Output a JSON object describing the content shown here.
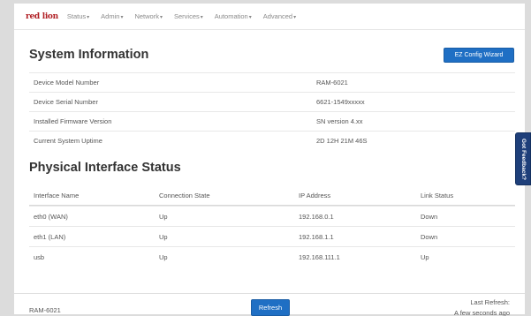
{
  "nav": {
    "logo": "red lion",
    "menu": [
      {
        "label": "Status"
      },
      {
        "label": "Admin"
      },
      {
        "label": "Network"
      },
      {
        "label": "Services"
      },
      {
        "label": "Automation"
      },
      {
        "label": "Advanced"
      }
    ]
  },
  "system_info": {
    "title": "System Information",
    "ez_button": "EZ Config Wizard",
    "rows": [
      {
        "key": "Device Model Number",
        "value": "RAM-6021"
      },
      {
        "key": "Device Serial Number",
        "value": "6621-1549xxxxx"
      },
      {
        "key": "Installed Firmware Version",
        "value": "SN version 4.xx"
      },
      {
        "key": "Current System Uptime",
        "value": "2D 12H 21M 46S"
      }
    ]
  },
  "interfaces": {
    "title": "Physical Interface Status",
    "headers": [
      "Interface Name",
      "Connection State",
      "IP Address",
      "Link Status"
    ],
    "rows": [
      {
        "name": "eth0 (WAN)",
        "state": "Up",
        "ip": "192.168.0.1",
        "link": "Down"
      },
      {
        "name": "eth1 (LAN)",
        "state": "Up",
        "ip": "192.168.1.1",
        "link": "Down"
      },
      {
        "name": "usb",
        "state": "Up",
        "ip": "192.168.111.1",
        "link": "Up"
      }
    ]
  },
  "footer": {
    "model": "RAM-6021",
    "refresh_label": "Refresh",
    "last_refresh_label": "Last Refresh:",
    "last_refresh_value": "A few seconds ago"
  },
  "feedback": {
    "label": "Got Feedback?"
  },
  "colors": {
    "accent": "#1f6fc4",
    "brand": "#b01e23",
    "feedback": "#1e3f7a"
  }
}
